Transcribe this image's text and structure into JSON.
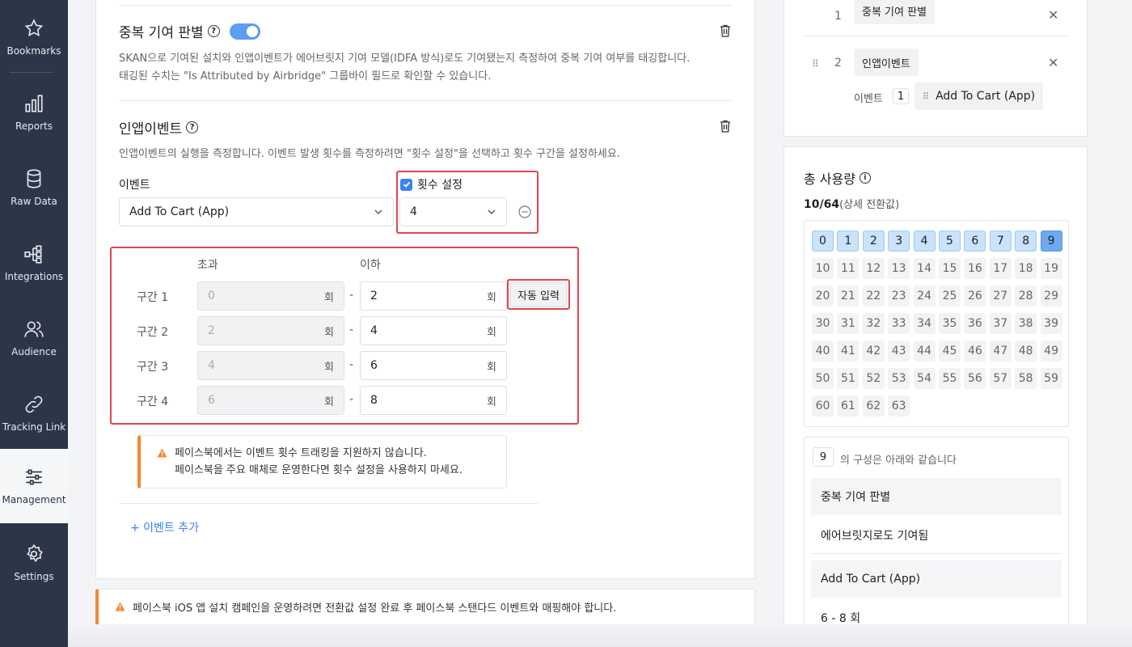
{
  "sidebar": {
    "items": [
      {
        "label": "Bookmarks",
        "icon": "star-icon"
      },
      {
        "label": "Reports",
        "icon": "bar-chart-icon"
      },
      {
        "label": "Raw Data",
        "icon": "database-icon"
      },
      {
        "label": "Integrations",
        "icon": "integrations-icon"
      },
      {
        "label": "Audience",
        "icon": "users-icon"
      },
      {
        "label": "Tracking Link",
        "icon": "link-icon"
      },
      {
        "label": "Management",
        "icon": "sliders-icon"
      },
      {
        "label": "Settings",
        "icon": "gear-icon"
      }
    ],
    "active": "Management"
  },
  "dedup": {
    "title": "중복 기여 판별",
    "toggle_on": true,
    "desc_line1": "SKAN으로 기여된 설치와 인앱이벤트가 에어브릿지 기여 모델(IDFA 방식)로도 기여됐는지 측정하여 중복 기여 여부를 태깅합니다.",
    "desc_line2": "태깅된 수치는 \"Is Attributed by Airbridge\" 그룹바이 필드로 확인할 수 있습니다."
  },
  "inapp": {
    "title": "인앱이벤트",
    "desc": "인앱이벤트의 실행을 측정합니다. 이벤트 발생 횟수를 측정하려면 \"횟수 설정\"을 선택하고 횟수 구간을 설정하세요.",
    "event_label": "이벤트",
    "event_value": "Add To Cart (App)",
    "count_label": "횟수 설정",
    "count_checked": true,
    "count_value": "4",
    "col_over": "초과",
    "col_under": "이하",
    "unit": "회",
    "auto_fill": "자동 입력",
    "ranges": [
      {
        "label": "구간 1",
        "from": "0",
        "to": "2"
      },
      {
        "label": "구간 2",
        "from": "2",
        "to": "4"
      },
      {
        "label": "구간 3",
        "from": "4",
        "to": "6"
      },
      {
        "label": "구간 4",
        "from": "6",
        "to": "8"
      }
    ],
    "warn_line1": "페이스북에서는 이벤트 횟수 트래킹을 지원하지 않습니다.",
    "warn_line2": "페이스북을 주요 매체로 운영한다면 횟수 설정을 사용하지 마세요.",
    "add_event": "+ 이벤트 추가"
  },
  "bottom_warning": "페이스북 iOS 앱 설치 캠페인을 운영하려면 전환값 설정 완료 후 페이스북 스탠다드 이벤트와 매핑해야 합니다.",
  "order_panel": {
    "items": [
      {
        "num": "1",
        "label": "중복 기여 판별"
      },
      {
        "num": "2",
        "label": "인앱이벤트"
      }
    ],
    "sub_label": "이벤트",
    "sub_num": "1",
    "sub_value": "Add To Cart (App)"
  },
  "usage": {
    "title": "총 사용량",
    "count": "10/64",
    "count_suffix": "(상세 전환값)",
    "used_values": [
      0,
      1,
      2,
      3,
      4,
      5,
      6,
      7,
      8,
      9
    ],
    "selected_value": 9,
    "total": 64,
    "selected_label": "9",
    "composition_text": "의 구성은 아래와 같습니다",
    "composition": [
      {
        "head": "중복 기여 판별",
        "value": "에어브릿지로도 기여됨"
      },
      {
        "head": "Add To Cart (App)",
        "value": "6 - 8 회"
      }
    ]
  },
  "colors": {
    "sidebar_bg": "#2d3648",
    "accent": "#3b82f6",
    "highlight": "#e0464e",
    "warning": "#f08a34"
  }
}
